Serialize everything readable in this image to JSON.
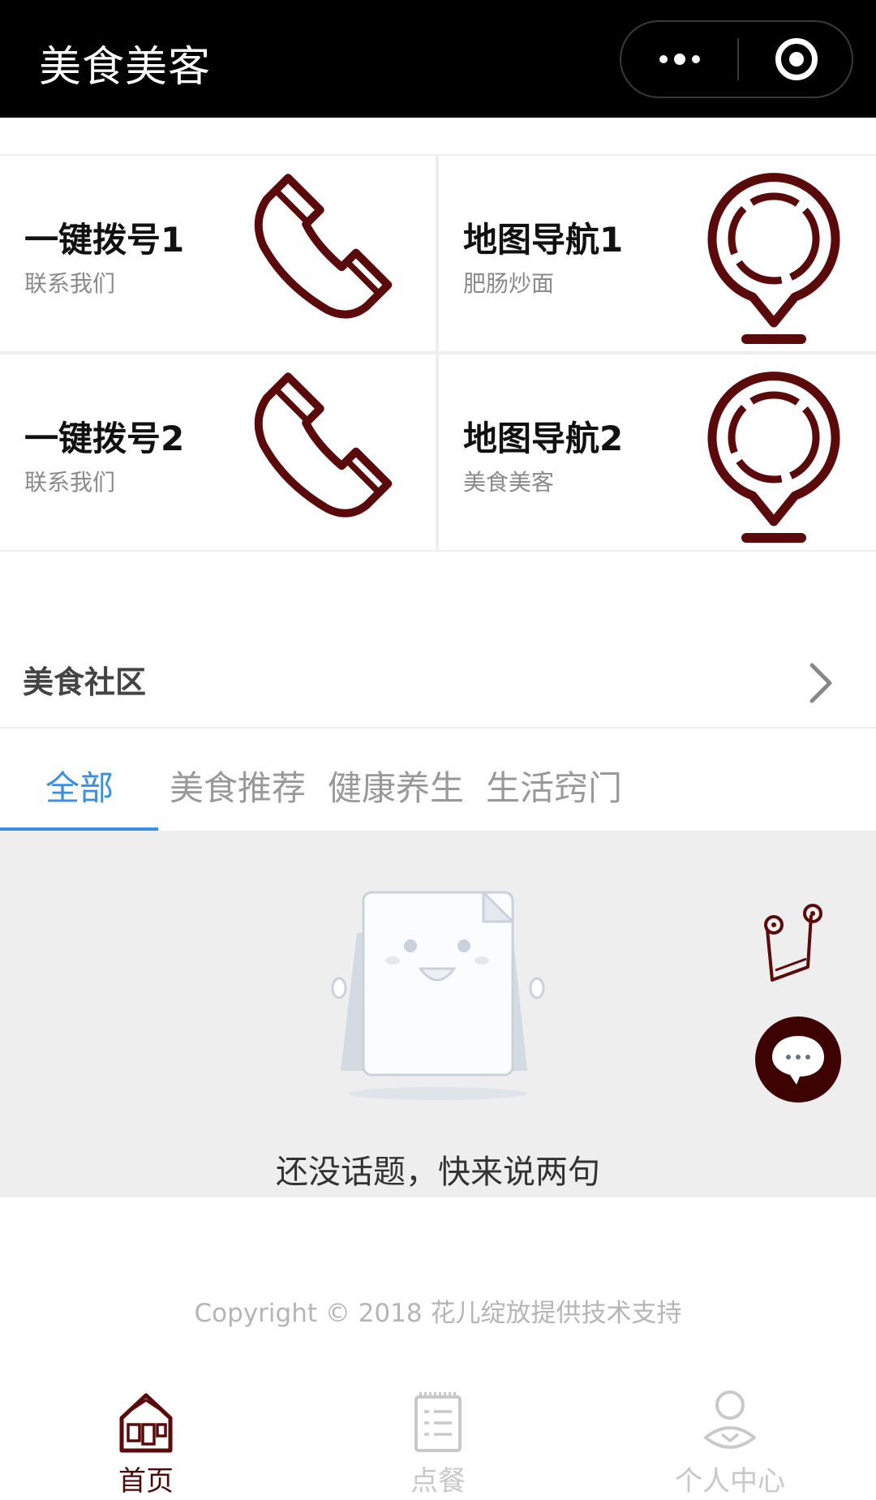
{
  "header": {
    "title": "美食美客"
  },
  "quick_grid": [
    {
      "title": "一键拨号1",
      "subtitle": "联系我们",
      "icon": "phone-icon"
    },
    {
      "title": "地图导航1",
      "subtitle": "肥肠炒面",
      "icon": "map-pin-icon"
    },
    {
      "title": "一键拨号2",
      "subtitle": "联系我们",
      "icon": "phone-icon"
    },
    {
      "title": "地图导航2",
      "subtitle": "美食美客",
      "icon": "map-pin-icon"
    }
  ],
  "community": {
    "title": "美食社区"
  },
  "tabs": [
    {
      "label": "全部",
      "active": true
    },
    {
      "label": "美食推荐",
      "active": false
    },
    {
      "label": "健康养生",
      "active": false
    },
    {
      "label": "生活窍门",
      "active": false
    }
  ],
  "empty_state": {
    "message": "还没话题，快来说两句"
  },
  "footer": {
    "copyright": "Copyright © 2018 花儿绽放提供技术支持"
  },
  "bottom_nav": [
    {
      "label": "首页",
      "icon": "home-icon",
      "active": true
    },
    {
      "label": "点餐",
      "icon": "order-list-icon",
      "active": false
    },
    {
      "label": "个人中心",
      "icon": "user-icon",
      "active": false
    }
  ],
  "colors": {
    "accent_dark": "#5a0a0a",
    "tab_active": "#3a8fe0",
    "header_bg": "#000000"
  }
}
